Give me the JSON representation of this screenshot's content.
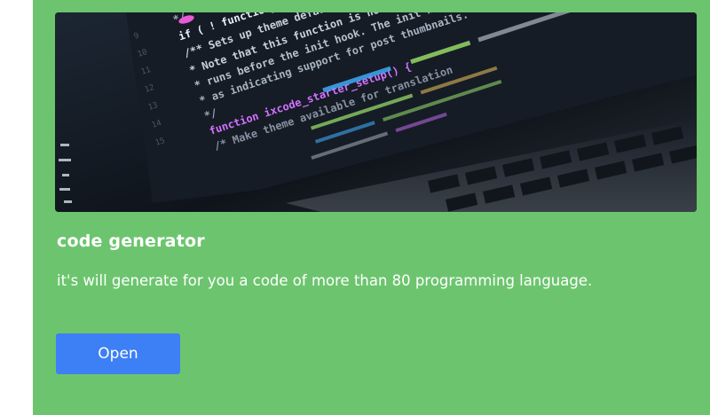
{
  "card": {
    "background": "#6cc56e",
    "image": {
      "alt": "laptop screen showing code",
      "code_lines": [
        "*/",
        "if ( ! function_exists( '",
        "/** Sets up theme defaults and regis",
        " * Note that this function is hooked into the",
        " * runs before the init hook. The init hook is too late",
        " * as indicating support for post thumbnails.",
        " */",
        "function  ixcode_starter_setup() {",
        "  /* Make theme available for translation"
      ]
    },
    "title": "code generator",
    "description": "it's will generate for you a code of more than 80 programming language.",
    "button": {
      "label": "Open",
      "color": "#3d7ff5"
    }
  }
}
